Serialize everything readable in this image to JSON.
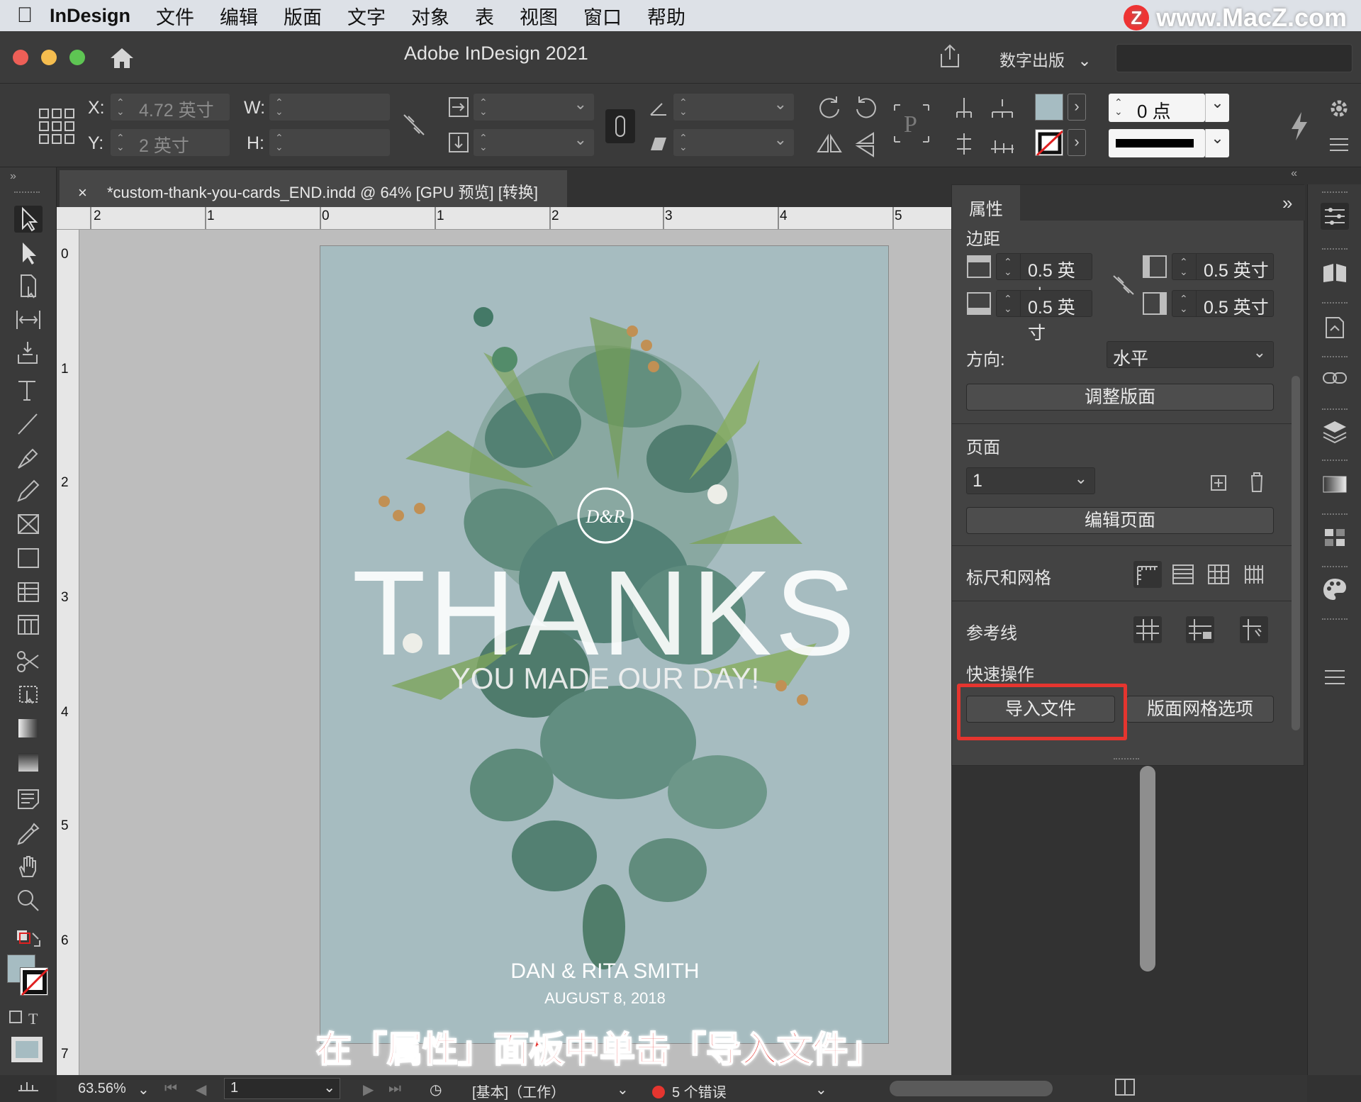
{
  "menubar": {
    "app_name": "InDesign",
    "items": [
      "文件",
      "编辑",
      "版面",
      "文字",
      "对象",
      "表",
      "视图",
      "窗口",
      "帮助"
    ]
  },
  "watermark": {
    "badge": "Z",
    "text": "www.MacZ.com"
  },
  "titlebar": {
    "title": "Adobe InDesign 2021",
    "workspace": "数字出版"
  },
  "controlbar": {
    "x_label": "X:",
    "x_value": "4.72 英寸",
    "y_label": "Y:",
    "y_value": "2 英寸",
    "w_label": "W:",
    "h_label": "H:",
    "stroke_weight": "0 点",
    "fill_color": "#a6bcc2"
  },
  "document": {
    "tab_title": "*custom-thank-you-cards_END.indd @ 64% [GPU 预览] [转换]",
    "close": "×"
  },
  "rulers": {
    "top": [
      "2",
      "1",
      "0",
      "1",
      "2",
      "3",
      "4",
      "5"
    ],
    "left": [
      "0",
      "1",
      "2",
      "3",
      "4",
      "5",
      "6",
      "7"
    ]
  },
  "card": {
    "monogram": "D&R",
    "headline": "THANKS",
    "tagline": "YOU MADE OUR DAY!",
    "names": "DAN & RITA SMITH",
    "date": "AUGUST 8, 2018",
    "background": "#a6bcc0"
  },
  "caption": "在「属性」面板中单击「导入文件」",
  "properties": {
    "tab": "属性",
    "margins_title": "边距",
    "margin_top": "0.5 英寸",
    "margin_bottom": "0.5 英寸",
    "margin_left": "0.5 英寸",
    "margin_right": "0.5 英寸",
    "orientation_label": "方向:",
    "orientation_value": "水平",
    "adjust_layout": "调整版面",
    "pages_title": "页面",
    "page_value": "1",
    "edit_page": "编辑页面",
    "rulers_grids": "标尺和网格",
    "guides": "参考线",
    "quick_actions": "快速操作",
    "import_file": "导入文件",
    "layout_grid_options": "版面网格选项"
  },
  "statusbar": {
    "zoom": "63.56%",
    "page": "1",
    "profile": "[基本]（工作）",
    "errors": "5 个错误",
    "error_color": "#e5352f"
  }
}
